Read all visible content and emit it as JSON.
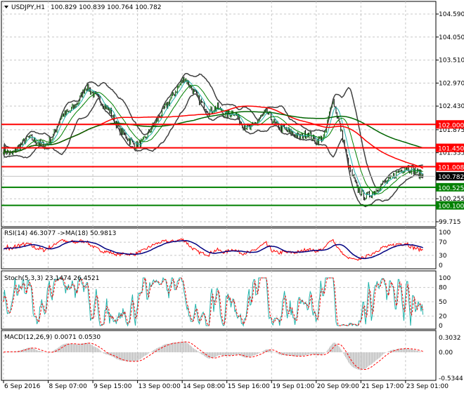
{
  "chart_data": {
    "type": "line",
    "symbol_title": "USDJPY,H1",
    "ohlc_text": "100.829 100.839 100.764 100.782",
    "price_ticks": [
      "104.590",
      "104.050",
      "103.510",
      "102.970",
      "102.430",
      "101.875",
      "101.335",
      "100.255",
      "99.715"
    ],
    "ylim": [
      99.715,
      104.59
    ],
    "levels": [
      {
        "label": "102.000",
        "value": 102.0,
        "color": "#ff0000"
      },
      {
        "label": "101.450",
        "value": 101.45,
        "color": "#ff0000"
      },
      {
        "label": "101.008",
        "value": 101.008,
        "color": "#ff0000"
      },
      {
        "label": "100.525",
        "value": 100.525,
        "color": "#008000"
      },
      {
        "label": "100.100",
        "value": 100.1,
        "color": "#008000"
      }
    ],
    "current_price": {
      "label": "100.782",
      "value": 100.782
    },
    "close_keypoints": [
      101.4,
      101.3,
      101.5,
      101.7,
      101.6,
      101.5,
      101.7,
      102.2,
      102.3,
      102.5,
      102.9,
      102.7,
      102.5,
      102.3,
      101.9,
      101.7,
      101.5,
      101.6,
      101.9,
      102.2,
      102.5,
      102.8,
      103.1,
      102.8,
      102.5,
      102.3,
      102.4,
      102.2,
      102.3,
      102.0,
      101.9,
      102.1,
      102.3,
      102.0,
      101.9,
      101.8,
      101.7,
      101.8,
      101.6,
      101.7,
      102.6,
      101.9,
      101.0,
      100.5,
      100.3,
      100.4,
      100.6,
      100.7,
      100.9,
      101.0,
      100.9,
      100.78
    ],
    "x_tick_labels": [
      "6 Sep 2016",
      "8 Sep 07:00",
      "9 Sep 15:00",
      "13 Sep 00:00",
      "14 Sep 08:00",
      "15 Sep 16:00",
      "19 Sep 01:00",
      "20 Sep 09:00",
      "21 Sep 17:00",
      "23 Sep 01:00"
    ],
    "rsi": {
      "title": "RSI(14) 46.3077  ->MA(18) 50.9813",
      "ticks": [
        "100",
        "70",
        "30",
        "0"
      ],
      "ylim": [
        0,
        100
      ]
    },
    "stoch": {
      "title": "Stoch(5,3,3) 23.1474 26.4521",
      "ticks": [
        "100",
        "80",
        "50",
        "20",
        "0"
      ],
      "ylim": [
        0,
        100
      ]
    },
    "macd": {
      "title": "MACD(12,26,9) 0.0071 0.0530",
      "ticks": [
        "0.3032",
        "0.00",
        "-0.5344"
      ],
      "ylim": [
        -0.5344,
        0.3032
      ]
    },
    "colors": {
      "rsi": "#ff0000",
      "rsi_ma": "#000080",
      "stoch_main": "#20b2aa",
      "stoch_signal": "#ff0000",
      "macd_hist": "#c0c0c0",
      "macd_signal": "#ff0000",
      "ma_fast": "#008000",
      "ma_slow": "#ff0000",
      "bands": "#404040"
    }
  }
}
